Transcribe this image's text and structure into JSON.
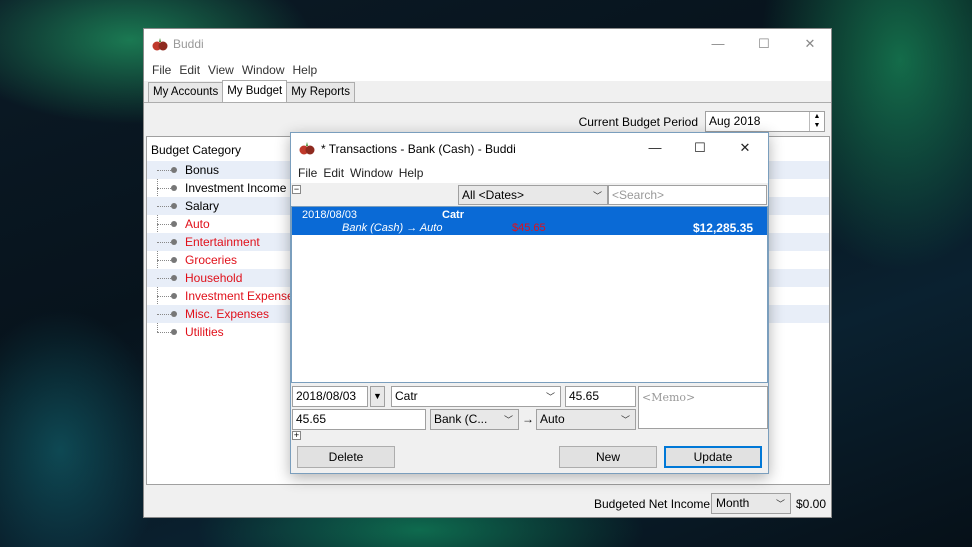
{
  "main_window": {
    "title": "Buddi",
    "controls": {
      "minimize": "—",
      "maximize": "☐",
      "close": "✕"
    },
    "menu": [
      "File",
      "Edit",
      "View",
      "Window",
      "Help"
    ],
    "tabs": [
      "My Accounts",
      "My Budget",
      "My Reports"
    ],
    "active_tab": "My Budget",
    "period": {
      "label": "Current Budget Period",
      "value": "Aug 2018"
    },
    "budget_header": "Budget Category",
    "categories": [
      {
        "name": "Bonus",
        "type": "income",
        "color": "#000000"
      },
      {
        "name": "Investment Income",
        "type": "income",
        "color": "#000000"
      },
      {
        "name": "Salary",
        "type": "income",
        "color": "#000000"
      },
      {
        "name": "Auto",
        "type": "expense",
        "color": "#e0101a"
      },
      {
        "name": "Entertainment",
        "type": "expense",
        "color": "#e0101a"
      },
      {
        "name": "Groceries",
        "type": "expense",
        "color": "#e0101a"
      },
      {
        "name": "Household",
        "type": "expense",
        "color": "#e0101a"
      },
      {
        "name": "Investment Expenses",
        "type": "expense",
        "color": "#e0101a"
      },
      {
        "name": "Misc. Expenses",
        "type": "expense",
        "color": "#e0101a"
      },
      {
        "name": "Utilities",
        "type": "expense",
        "color": "#e0101a"
      }
    ],
    "bottom": {
      "label": "Budgeted Net Income /",
      "period_select": "Month",
      "amount": "$0.00"
    }
  },
  "tx_window": {
    "title": "* Transactions - Bank (Cash) - Buddi",
    "controls": {
      "minimize": "—",
      "maximize": "☐",
      "close": "✕"
    },
    "menu": [
      "File",
      "Edit",
      "Window",
      "Help"
    ],
    "filter": {
      "dates": "All <Dates>",
      "search_placeholder": "<Search>"
    },
    "transaction": {
      "date": "2018/08/03",
      "description": "Catr",
      "accounts": "Bank (Cash) → Auto",
      "amount": "$45.65",
      "balance": "$12,285.35"
    },
    "editor": {
      "date": "2018/08/03",
      "description": "Catr",
      "amount_top": "45.65",
      "memo_placeholder": "<Memo>",
      "amount": "45.65",
      "from": "Bank (C...",
      "arrow": "→",
      "to": "Auto"
    },
    "buttons": {
      "delete": "Delete",
      "new": "New",
      "update": "Update"
    }
  },
  "colors": {
    "selection": "#0a6ad6",
    "expense": "#e0101a",
    "accent": "#0078d7"
  }
}
